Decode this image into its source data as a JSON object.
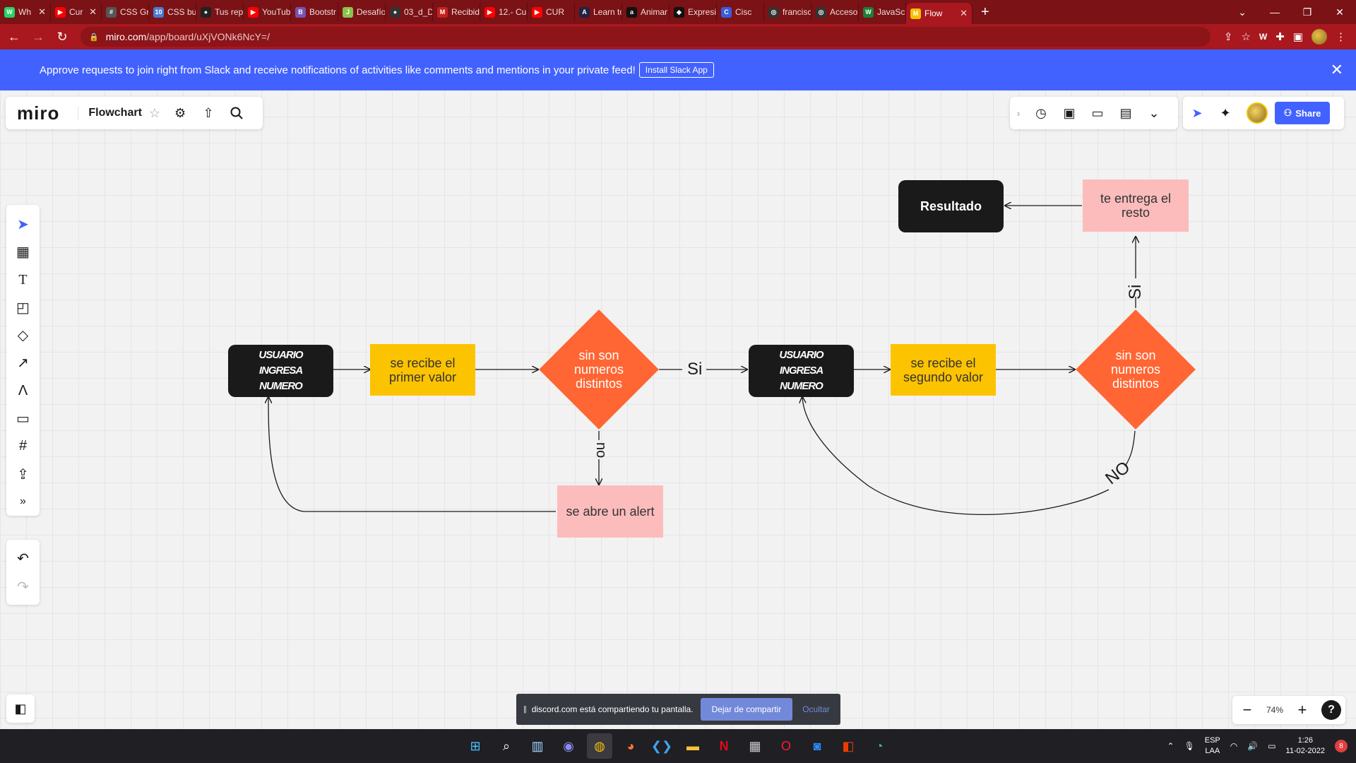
{
  "browser": {
    "tabs": [
      {
        "label": "Wh",
        "favicon_color": "#25d366",
        "favicon_glyph": "W"
      },
      {
        "label": "Cur",
        "favicon_color": "#ff0000",
        "favicon_glyph": "▶"
      },
      {
        "label": "CSS Gri",
        "favicon_color": "#555555",
        "favicon_glyph": "#"
      },
      {
        "label": "CSS but",
        "favicon_color": "#4a7bd0",
        "favicon_glyph": "10"
      },
      {
        "label": "Tus rep",
        "favicon_color": "#222222",
        "favicon_glyph": "●"
      },
      {
        "label": "YouTub",
        "favicon_color": "#ff0000",
        "favicon_glyph": "▶"
      },
      {
        "label": "Bootstr",
        "favicon_color": "#7952b3",
        "favicon_glyph": "B"
      },
      {
        "label": "Desafío",
        "favicon_color": "#8bc34a",
        "favicon_glyph": "J"
      },
      {
        "label": "03_d_D",
        "favicon_color": "#333333",
        "favicon_glyph": "●"
      },
      {
        "label": "Recibid",
        "favicon_color": "#c5221f",
        "favicon_glyph": "M"
      },
      {
        "label": "12.- Cur",
        "favicon_color": "#ff0000",
        "favicon_glyph": "▶"
      },
      {
        "label": "CUR",
        "favicon_color": "#ff0000",
        "favicon_glyph": "▶"
      },
      {
        "label": "Learn to",
        "favicon_color": "#222244",
        "favicon_glyph": "A"
      },
      {
        "label": "Animar",
        "favicon_color": "#111111",
        "favicon_glyph": "a"
      },
      {
        "label": "Expresi",
        "favicon_color": "#111111",
        "favicon_glyph": "◆"
      },
      {
        "label": "Cisc",
        "favicon_color": "#3b5bdb",
        "favicon_glyph": "C"
      },
      {
        "label": "francisc",
        "favicon_color": "#333333",
        "favicon_glyph": "◎"
      },
      {
        "label": "Acceso",
        "favicon_color": "#333333",
        "favicon_glyph": "◎"
      },
      {
        "label": "JavaScr",
        "favicon_color": "#1a7f37",
        "favicon_glyph": "W"
      },
      {
        "label": "Flow",
        "favicon_color": "#f5c000",
        "favicon_glyph": "M",
        "active": true
      }
    ],
    "url_host": "miro.com",
    "url_path": "/app/board/uXjVONk6NcY=/"
  },
  "banner": {
    "text": "Approve requests to join right from Slack and receive notifications of activities like comments and mentions in your private feed!",
    "button": "Install Slack App"
  },
  "miro": {
    "logo": "miro",
    "board_title": "Flowchart",
    "share_label": "Share",
    "zoom": "74%",
    "help": "?"
  },
  "diagram": {
    "nodes": {
      "user_input_1": "USUARIO INGRESA NUMERO",
      "receive_first": "se recibe el primer valor",
      "decision_1": "sin son numeros distintos",
      "alert": "se abre un alert",
      "user_input_2": "USUARIO INGRESA NUMERO",
      "receive_second": "se recibe el segundo valor",
      "decision_2": "sin son numeros distintos",
      "remainder": "te entrega el resto",
      "result": "Resultado"
    },
    "edge_labels": {
      "yes_1": "Si",
      "no_1": "no",
      "yes_2": "Si",
      "no_2": "NO"
    }
  },
  "discord": {
    "message": "discord.com está compartiendo tu pantalla.",
    "stop": "Dejar de compartir",
    "hide": "Ocultar"
  },
  "taskbar": {
    "lang_line1": "ESP",
    "lang_line2": "LAA",
    "time": "1:26",
    "date": "11-02-2022",
    "notifications": "8"
  }
}
